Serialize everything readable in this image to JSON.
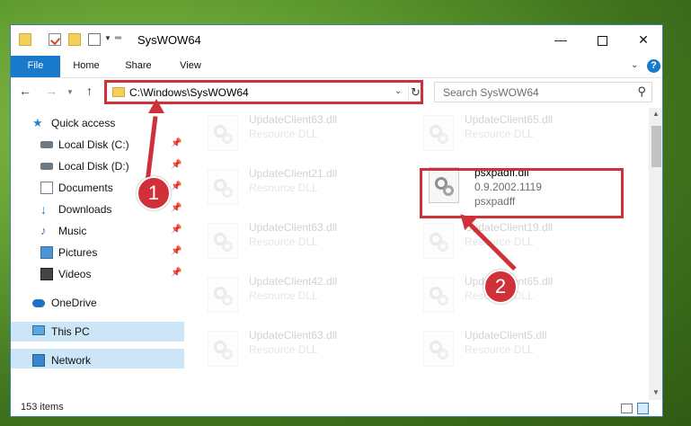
{
  "window": {
    "title": "SysWOW64",
    "controls": {
      "minimize": "—",
      "maximize": "",
      "close": "✕"
    }
  },
  "ribbon": {
    "tabs": [
      "File",
      "Home",
      "Share",
      "View"
    ]
  },
  "nav": {
    "address": "C:\\Windows\\SysWOW64",
    "search_placeholder": "Search SysWOW64"
  },
  "sidebar": {
    "items": [
      {
        "label": "Quick access",
        "icon": "star-icon",
        "pinned": false
      },
      {
        "label": "Local Disk (C:)",
        "icon": "drive-icon",
        "pinned": true
      },
      {
        "label": "Local Disk (D:)",
        "icon": "drive-icon",
        "pinned": true
      },
      {
        "label": "Documents",
        "icon": "documents-icon",
        "pinned": true
      },
      {
        "label": "Downloads",
        "icon": "download-icon",
        "pinned": true
      },
      {
        "label": "Music",
        "icon": "music-icon",
        "pinned": true
      },
      {
        "label": "Pictures",
        "icon": "pictures-icon",
        "pinned": true
      },
      {
        "label": "Videos",
        "icon": "videos-icon",
        "pinned": true
      },
      {
        "label": "OneDrive",
        "icon": "cloud-icon"
      },
      {
        "label": "This PC",
        "icon": "computer-icon",
        "selected": true
      },
      {
        "label": "Network",
        "icon": "network-icon"
      }
    ]
  },
  "files": [
    {
      "name": "UpdateClient63.dll",
      "meta1": "Resource DLL",
      "meta2": ""
    },
    {
      "name": "UpdateClient65.dll",
      "meta1": "Resource DLL",
      "meta2": ""
    },
    {
      "name": "UpdateClient21.dll",
      "meta1": "Resource DLL",
      "meta2": ""
    },
    {
      "name": "psxpadff.dll",
      "meta1": "0.9.2002.1119",
      "meta2": "psxpadff"
    },
    {
      "name": "UpdateClient63.dll",
      "meta1": "Resource DLL",
      "meta2": ""
    },
    {
      "name": "UpdateClient19.dll",
      "meta1": "Resource DLL",
      "meta2": ""
    },
    {
      "name": "UpdateClient42.dll",
      "meta1": "Resource DLL",
      "meta2": ""
    },
    {
      "name": "UpdateClient65.dll",
      "meta1": "Resource DLL",
      "meta2": ""
    },
    {
      "name": "UpdateClient63.dll",
      "meta1": "Resource DLL",
      "meta2": ""
    },
    {
      "name": "UpdateClient5.dll",
      "meta1": "Resource DLL",
      "meta2": ""
    }
  ],
  "status": {
    "item_count": "153 items"
  },
  "callouts": {
    "one": "1",
    "two": "2"
  },
  "colors": {
    "accent": "#1979ca",
    "highlight": "#d0303a",
    "selected": "#cce6f7"
  }
}
